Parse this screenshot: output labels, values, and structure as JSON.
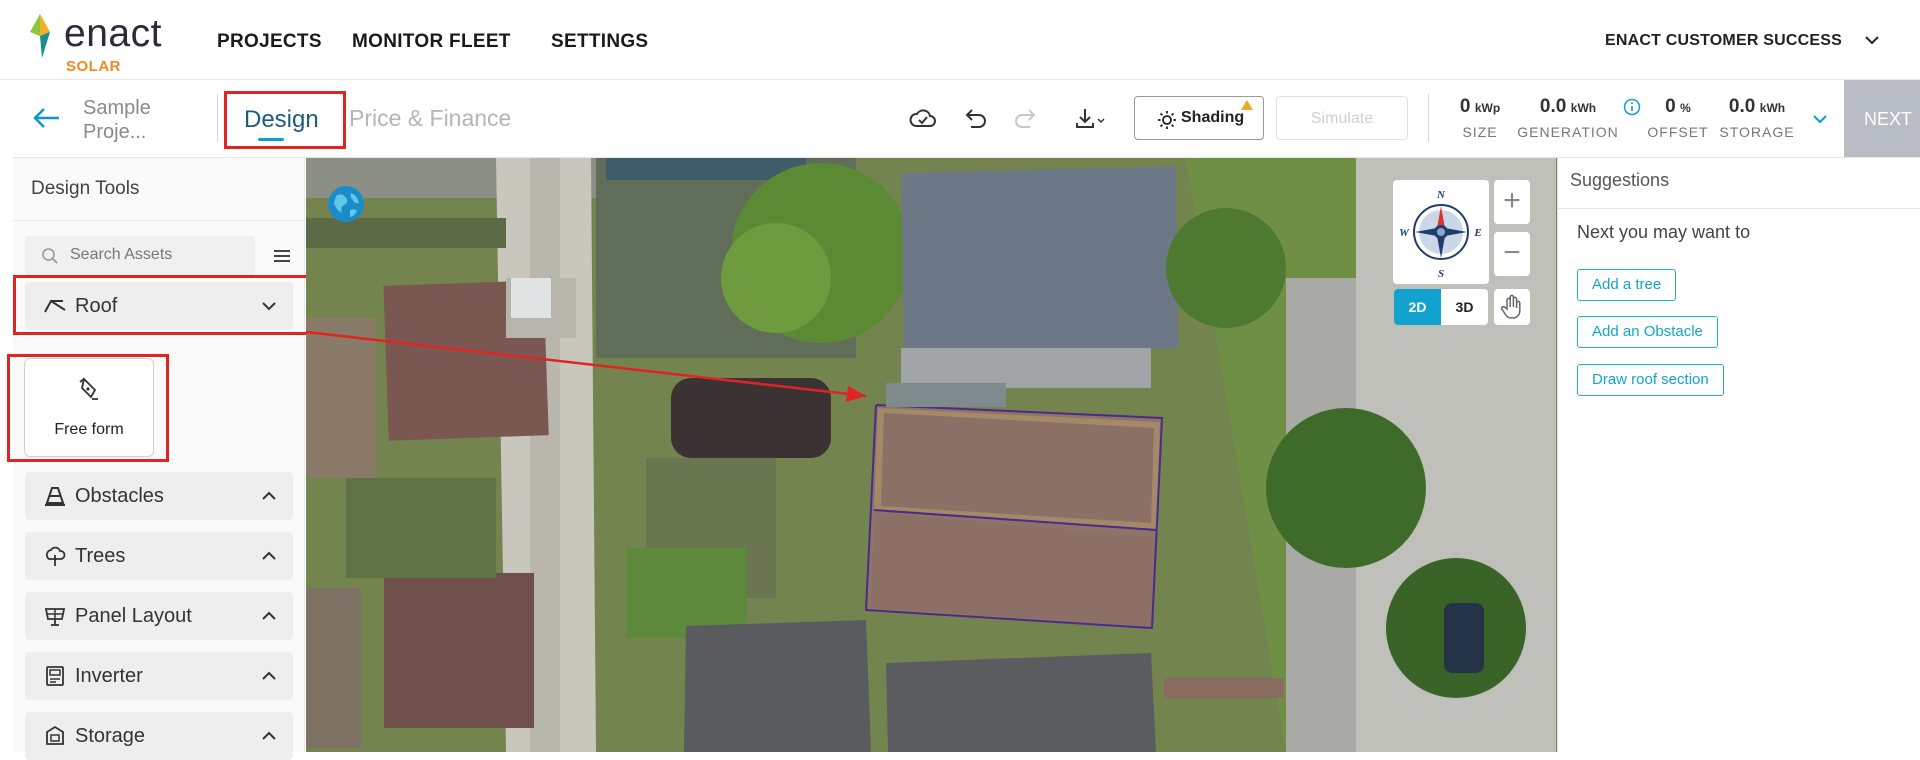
{
  "brand": {
    "name": "enact",
    "sub": "SOLAR"
  },
  "nav": {
    "items": [
      "PROJECTS",
      "MONITOR FLEET",
      "SETTINGS"
    ],
    "account": "ENACT CUSTOMER SUCCESS"
  },
  "project": {
    "name_line1": "Sample",
    "name_line2": "Proje...",
    "tab_design": "Design",
    "tab_price": "Price & Finance"
  },
  "toolbar": {
    "shading_label": "Shading",
    "simulate_label": "Simulate"
  },
  "stats": [
    {
      "value": "0",
      "unit": "kWp",
      "label": "SIZE"
    },
    {
      "value": "0.0",
      "unit": "kWh",
      "label": "GENERATION"
    },
    {
      "value": "0",
      "unit": "%",
      "label": "OFFSET"
    },
    {
      "value": "0.0",
      "unit": "kWh",
      "label": "STORAGE"
    }
  ],
  "next_label": "NEXT",
  "design_tools": {
    "title": "Design Tools",
    "search_placeholder": "Search Assets",
    "categories": [
      {
        "label": "Roof",
        "icon": "roof-icon",
        "expanded": true
      },
      {
        "label": "Obstacles",
        "icon": "cone-icon",
        "expanded": false
      },
      {
        "label": "Trees",
        "icon": "tree-icon",
        "expanded": false
      },
      {
        "label": "Panel Layout",
        "icon": "panel-icon",
        "expanded": false
      },
      {
        "label": "Inverter",
        "icon": "inverter-icon",
        "expanded": false
      },
      {
        "label": "Storage",
        "icon": "battery-icon",
        "expanded": false
      }
    ],
    "roof_tool": "Free form"
  },
  "map": {
    "compass": {
      "n": "N",
      "s": "S",
      "e": "E",
      "w": "W"
    },
    "view_2d": "2D",
    "view_3d": "3D",
    "active_view": "2D"
  },
  "suggestions": {
    "title": "Suggestions",
    "subtitle": "Next you may want to",
    "items": [
      "Add a tree",
      "Add an Obstacle",
      "Draw roof section"
    ]
  },
  "colors": {
    "accent": "#11a3cd",
    "brand_orange": "#f08a24",
    "highlight_red": "#e02424",
    "roof_outline": "#4b2a8a"
  }
}
